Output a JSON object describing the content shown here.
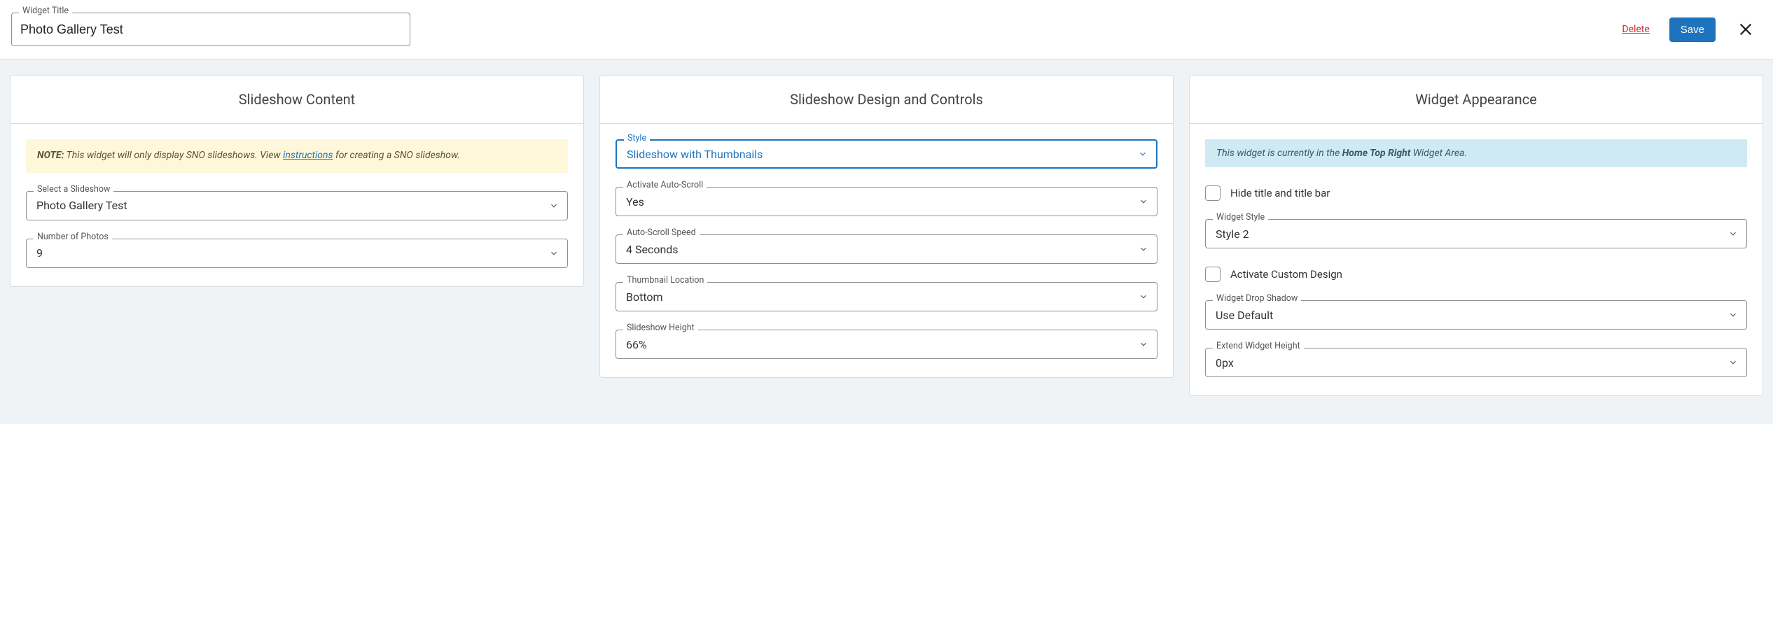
{
  "header": {
    "widget_title_label": "Widget Title",
    "widget_title_value": "Photo Gallery Test",
    "delete_label": "Delete",
    "save_label": "Save"
  },
  "panel1": {
    "title": "Slideshow Content",
    "note_strong": "NOTE:",
    "note_text_a": " This widget will only display SNO slideshows. View ",
    "note_link": "instructions",
    "note_text_b": " for creating a SNO slideshow.",
    "select_slideshow_label": "Select a Slideshow",
    "select_slideshow_value": "Photo Gallery Test",
    "num_photos_label": "Number of Photos",
    "num_photos_value": "9"
  },
  "panel2": {
    "title": "Slideshow Design and Controls",
    "style_label": "Style",
    "style_value": "Slideshow with Thumbnails",
    "auto_scroll_label": "Activate Auto-Scroll",
    "auto_scroll_value": "Yes",
    "speed_label": "Auto-Scroll Speed",
    "speed_value": "4 Seconds",
    "thumb_loc_label": "Thumbnail Location",
    "thumb_loc_value": "Bottom",
    "height_label": "Slideshow Height",
    "height_value": "66%"
  },
  "panel3": {
    "title": "Widget Appearance",
    "info_text_a": "This widget is currently in the ",
    "info_area": "Home Top Right",
    "info_text_b": " Widget Area.",
    "hide_title_label": "Hide title and title bar",
    "widget_style_label": "Widget Style",
    "widget_style_value": "Style 2",
    "custom_design_label": "Activate Custom Design",
    "drop_shadow_label": "Widget Drop Shadow",
    "drop_shadow_value": "Use Default",
    "extend_height_label": "Extend Widget Height",
    "extend_height_value": "0px"
  }
}
